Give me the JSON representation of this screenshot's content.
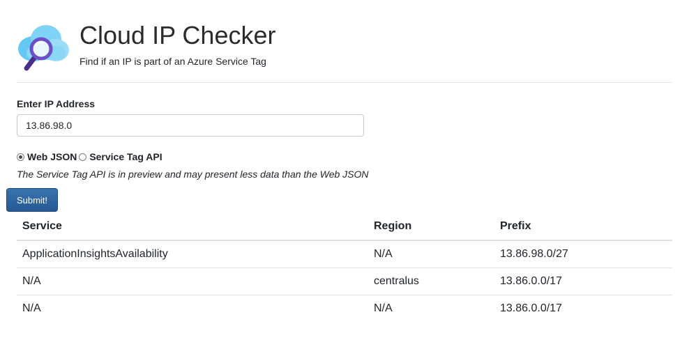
{
  "header": {
    "title": "Cloud IP Checker",
    "subtitle": "Find if an IP is part of an Azure Service Tag",
    "logo_icon": "cloud-magnifier-icon"
  },
  "form": {
    "ip_label": "Enter IP Address",
    "ip_value": "13.86.98.0",
    "options": [
      {
        "label": "Web JSON",
        "checked": true
      },
      {
        "label": "Service Tag API",
        "checked": false
      }
    ],
    "note": "The Service Tag API is in preview and may present less data than the Web JSON",
    "submit_label": "Submit!"
  },
  "results": {
    "columns": [
      "Service",
      "Region",
      "Prefix"
    ],
    "rows": [
      [
        "ApplicationInsightsAvailability",
        "N/A",
        "13.86.98.0/27"
      ],
      [
        "N/A",
        "centralus",
        "13.86.0.0/17"
      ],
      [
        "N/A",
        "N/A",
        "13.86.0.0/17"
      ]
    ]
  },
  "colors": {
    "accent": "#255a92",
    "text": "#212529",
    "border": "#dee2e6"
  }
}
